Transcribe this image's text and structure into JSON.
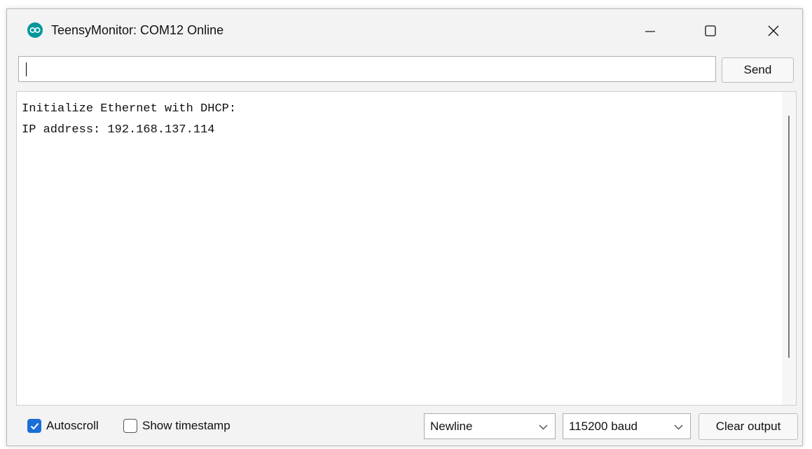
{
  "window": {
    "title": "TeensyMonitor: COM12 Online",
    "controls": {
      "minimize_icon": "minimize-icon",
      "maximize_icon": "maximize-icon",
      "close_icon": "close-icon"
    }
  },
  "send_bar": {
    "input_value": "",
    "send_label": "Send"
  },
  "output": {
    "lines": [
      "Initialize Ethernet with DHCP:",
      "IP address: 192.168.137.114"
    ]
  },
  "footer": {
    "autoscroll": {
      "label": "Autoscroll",
      "checked": true
    },
    "show_timestamp": {
      "label": "Show timestamp",
      "checked": false
    },
    "line_ending": {
      "selected": "Newline"
    },
    "baud_rate": {
      "selected": "115200 baud"
    },
    "clear_label": "Clear output"
  },
  "colors": {
    "app_icon": "#00979c",
    "checkbox_accent": "#1a6fd6"
  }
}
